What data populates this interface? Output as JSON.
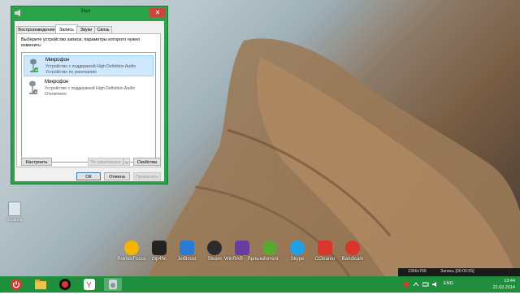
{
  "dialog": {
    "title": "Звук",
    "tabs": [
      {
        "label": "Воспроизведение"
      },
      {
        "label": "Запись"
      },
      {
        "label": "Звуки"
      },
      {
        "label": "Связь"
      }
    ],
    "instruction": "Выберите устройство записи, параметры которого нужно изменить:",
    "devices": [
      {
        "name": "Микрофон",
        "line1": "Устройство с поддержкой High Definition Audio",
        "line2": "Устройство по умолчанию",
        "status_icon": "check-icon"
      },
      {
        "name": "Микрофон",
        "line1": "Устройство с поддержкой High Definition Audio",
        "line2": "Отключено",
        "status_icon": "down-arrow-icon"
      }
    ],
    "configure_label": "Настроить",
    "default_label": "По умолчанию",
    "properties_label": "Свойства",
    "ok_label": "ОК",
    "cancel_label": "Отмена",
    "apply_label": "Применить",
    "close_glyph": "✕"
  },
  "desktop": {
    "recycle_label": "Корзина",
    "icons": [
      {
        "label": "PointerFocus",
        "color": "#f4b400"
      },
      {
        "label": "mp4hc",
        "color": "#222222"
      },
      {
        "label": "JetBoost",
        "color": "#2a7bd4"
      },
      {
        "label": "Steam",
        "color": "#2b2b2b"
      },
      {
        "label": "WinRAR - Ярлык",
        "color": "#6a3ba0"
      },
      {
        "label": "utorrent",
        "color": "#5aa832"
      },
      {
        "label": "Skype",
        "color": "#1ea1e6"
      },
      {
        "label": "CCleaner",
        "color": "#d9352b"
      },
      {
        "label": "Bandicam",
        "color": "#d9352b"
      }
    ]
  },
  "recorder": {
    "resolution": "1366x768",
    "status": "Запись [00:00:55]"
  },
  "taskbar": {
    "lang": "ENG",
    "time": "13:44",
    "date": "22.02.2014"
  },
  "colors": {
    "taskbar": "#1f8f3d",
    "dialog_frame": "#2ba34b"
  }
}
